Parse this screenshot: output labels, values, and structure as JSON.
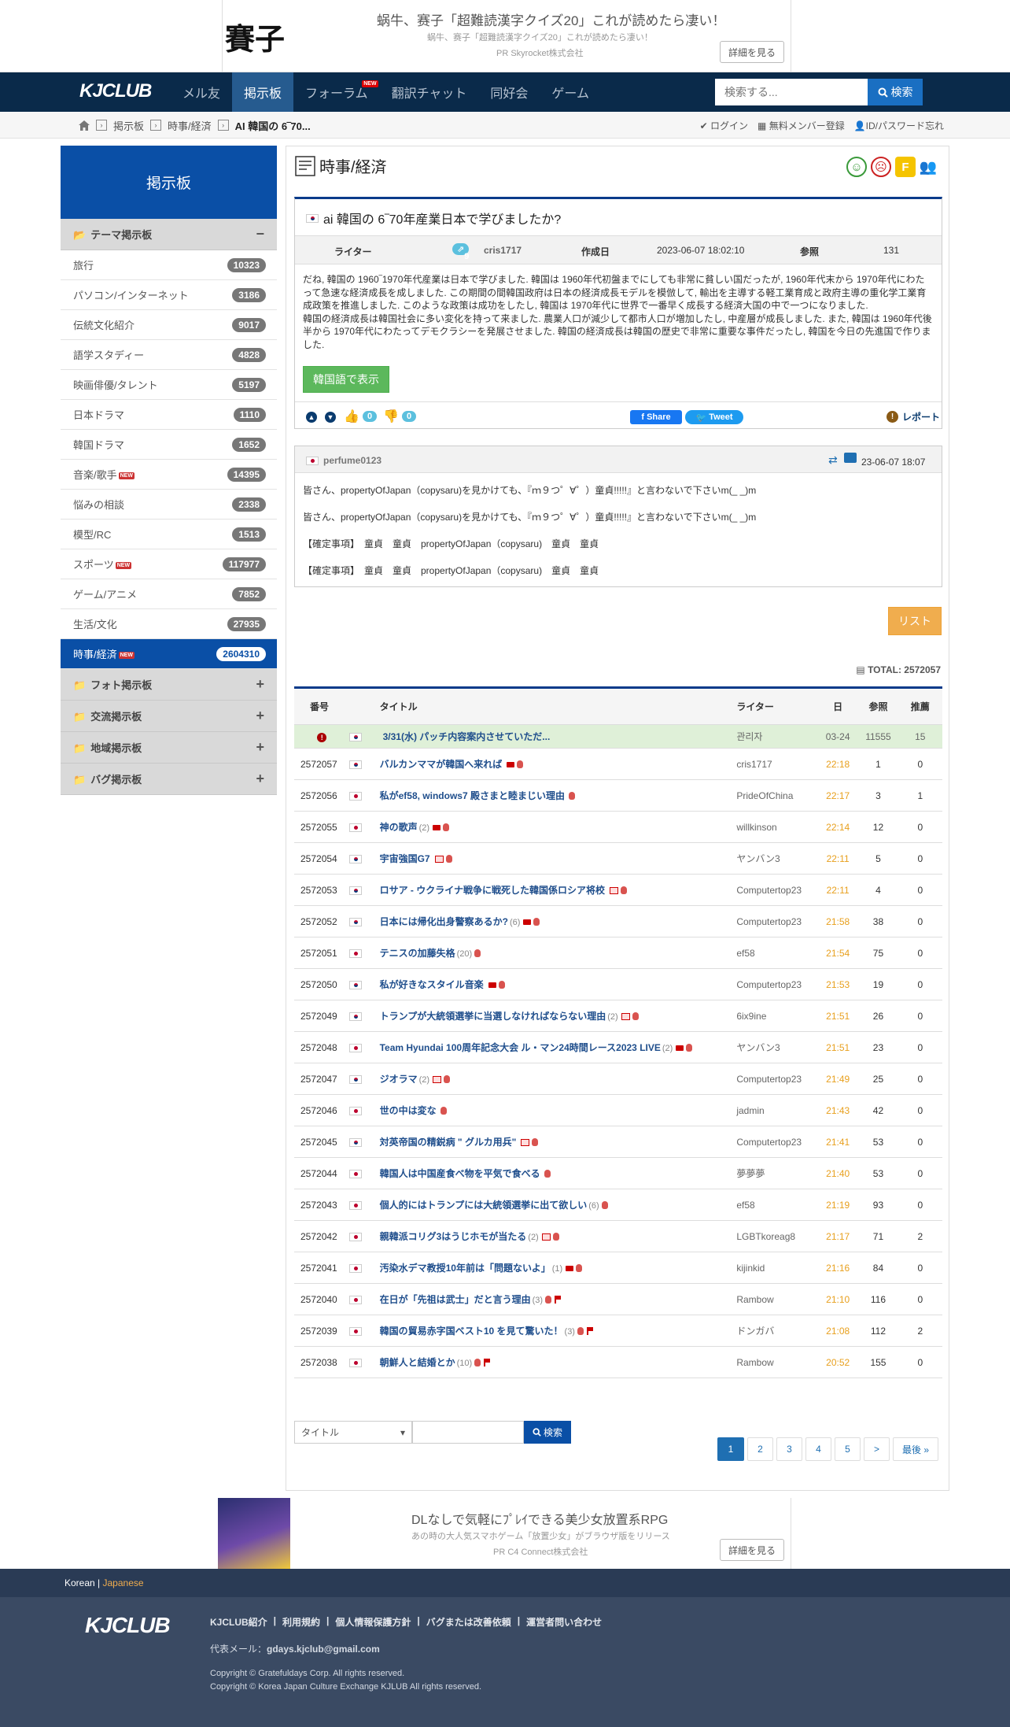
{
  "top_ad": {
    "thumb": "賽子",
    "headline": "蜗牛、赛子「超難読漢字クイズ20」これが読めたら凄い！",
    "sub": "蜗牛、赛子「超難読漢字クイズ20」これが読めたら凄い！",
    "pr": "PR  Skyrocket株式会社",
    "more": "詳細を見る"
  },
  "navbar": {
    "logo": "KJCLUB",
    "items": [
      "メル友",
      "掲示板",
      "フォーラム",
      "翻訳チャット",
      "同好会",
      "ゲーム"
    ],
    "new_badge": "NEW",
    "search_placeholder": "検索する...",
    "search_btn": "検索"
  },
  "breadcrumb": {
    "items": [
      "掲示板",
      "時事/経済",
      "AI 韓国の 6‾70..."
    ]
  },
  "account": {
    "login": "ログイン",
    "register": "無料メンバー登録",
    "forgot": "ID/パスワード忘れ"
  },
  "sidebar": {
    "title": "掲示板",
    "section_theme": "テーマ掲示板",
    "items": [
      {
        "label": "旅行",
        "count": "10323"
      },
      {
        "label": "パソコン/インターネット",
        "count": "3186"
      },
      {
        "label": "伝統文化紹介",
        "count": "9017"
      },
      {
        "label": "語学スタディー",
        "count": "4828"
      },
      {
        "label": "映画俳優/タレント",
        "count": "5197"
      },
      {
        "label": "日本ドラマ",
        "count": "1110"
      },
      {
        "label": "韓国ドラマ",
        "count": "1652"
      },
      {
        "label": "音楽/歌手",
        "count": "14395"
      },
      {
        "label": "悩みの相談",
        "count": "2338"
      },
      {
        "label": "模型/RC",
        "count": "1513"
      },
      {
        "label": "スポーツ",
        "count": "117977"
      },
      {
        "label": "ゲーム/アニメ",
        "count": "7852"
      },
      {
        "label": "生活/文化",
        "count": "27935"
      },
      {
        "label": "時事/経済",
        "count": "2604310"
      }
    ],
    "sections": [
      "フォト掲示板",
      "交流掲示板",
      "地域掲示板",
      "バグ掲示板"
    ]
  },
  "main": {
    "title": "時事/経済",
    "post": {
      "subject": "ai 韓国の 6‾70年産業日本で学びましたか?",
      "writer_label": "ライター",
      "level": "9",
      "writer": "cris1717",
      "date_label": "作成日",
      "date": "2023-06-07 18:02:10",
      "views_label": "参照",
      "views": "131",
      "body": "だね, 韓国の 1960‾1970年代産業は日本で学びました. 韓国は 1960年代初盤までにしても非常に貧しい国だったが, 1960年代末から 1970年代にわたって急速な経済成長を成しました. この期間の間韓国政府は日本の経済成長モデルを模倣して, 輸出を主導する軽工業育成と政府主導の重化学工業育成政策を推進しました. このような政策は成功をしたし, 韓国は 1970年代に世界で一番早く成長する経済大国の中で一つになりました.\n韓国の経済成長は韓国社会に多い変化を持って来ました. 農業人口が減少して都市人口が増加したし, 中産層が成長しました. また, 韓国は 1960年代後半から 1970年代にわたってデモクラシーを発展させました. 韓国の経済成長は韓国の歴史で非常に重要な事件だったし, 韓国を今日の先進国で作りました.",
      "btn_korean": "韓国語で表示",
      "likes": "0",
      "dislikes": "0",
      "share": "Share",
      "tweet": "Tweet",
      "report": "レポート"
    },
    "comment": {
      "writer": "perfume0123",
      "date": "23-06-07 18:07",
      "lines": [
        "皆さん、propertyOfJapan（copysaru)を見かけても、『ｍ９つ゜∀゜）童貞!!!!!』と言わないで下さいm(_ _)m",
        "皆さん、propertyOfJapan（copysaru)を見かけても、『ｍ９つ゜∀゜）童貞!!!!!』と言わないで下さいm(_ _)m",
        "【確定事項】　童貞　童貞　propertyOfJapan（copysaru)　童貞　童貞",
        "【確定事項】　童貞　童貞　propertyOfJapan（copysaru)　童貞　童貞"
      ]
    },
    "list_btn": "リスト",
    "total": "TOTAL: 2572057",
    "table": {
      "headers": [
        "番号",
        "タイトル",
        "ライター",
        "日",
        "参照",
        "推薦"
      ],
      "notice": {
        "flag": "kr",
        "title": "3/31(水) パッチ内容案内させていただ...",
        "writer": "관리자",
        "date": "03-24",
        "views": "11555",
        "rec": "15"
      },
      "rows": [
        {
          "no": "2572057",
          "flag": "kr",
          "title": "バルカンママが韓国へ来れば",
          "rep": "",
          "icons": [
            "v",
            "f"
          ],
          "writer": "cris1717",
          "time": "22:18",
          "views": "1",
          "rec": "0"
        },
        {
          "no": "2572056",
          "flag": "jp",
          "title": "私がef58, windows7 殿さまと睦まじい理由",
          "rep": "",
          "icons": [
            "f"
          ],
          "writer": "PrideOfChina",
          "time": "22:17",
          "views": "3",
          "rec": "1"
        },
        {
          "no": "2572055",
          "flag": "jp",
          "title": "神の歌声",
          "rep": "(2)",
          "icons": [
            "v",
            "f"
          ],
          "writer": "willkinson",
          "time": "22:14",
          "views": "12",
          "rec": "0"
        },
        {
          "no": "2572054",
          "flag": "kr",
          "title": "宇宙強国G7",
          "rep": "",
          "icons": [
            "p",
            "f"
          ],
          "writer": "ヤンバン3",
          "time": "22:11",
          "views": "5",
          "rec": "0"
        },
        {
          "no": "2572053",
          "flag": "kr",
          "title": "ロサア - ウクライナ戦争に戦死した韓国係ロシア将校",
          "rep": "",
          "icons": [
            "p",
            "f"
          ],
          "writer": "Computertop23",
          "time": "22:11",
          "views": "4",
          "rec": "0"
        },
        {
          "no": "2572052",
          "flag": "kr",
          "title": "日本には帰化出身警察あるか?",
          "rep": "(6)",
          "icons": [
            "v",
            "f"
          ],
          "writer": "Computertop23",
          "time": "21:58",
          "views": "38",
          "rec": "0"
        },
        {
          "no": "2572051",
          "flag": "jp",
          "title": "テニスの加藤失格",
          "rep": "(20)",
          "icons": [
            "f"
          ],
          "writer": "ef58",
          "time": "21:54",
          "views": "75",
          "rec": "0"
        },
        {
          "no": "2572050",
          "flag": "kr",
          "title": "私が好きなスタイル音楽",
          "rep": "",
          "icons": [
            "v",
            "f"
          ],
          "writer": "Computertop23",
          "time": "21:53",
          "views": "19",
          "rec": "0"
        },
        {
          "no": "2572049",
          "flag": "kr",
          "title": "トランプが大統領選挙に当選しなければならない理由",
          "rep": "(2)",
          "icons": [
            "p",
            "f"
          ],
          "writer": "6ix9ine",
          "time": "21:51",
          "views": "26",
          "rec": "0"
        },
        {
          "no": "2572048",
          "flag": "jp",
          "title": "Team Hyundai 100周年記念大会 ル・マン24時間レース2023 LIVE",
          "rep": "(2)",
          "icons": [
            "v",
            "f"
          ],
          "writer": "ヤンバン3",
          "time": "21:51",
          "views": "23",
          "rec": "0"
        },
        {
          "no": "2572047",
          "flag": "kr",
          "title": "ジオラマ",
          "rep": "(2)",
          "icons": [
            "p",
            "f"
          ],
          "writer": "Computertop23",
          "time": "21:49",
          "views": "25",
          "rec": "0"
        },
        {
          "no": "2572046",
          "flag": "jp",
          "title": "世の中は変な",
          "rep": "",
          "icons": [
            "f"
          ],
          "writer": "jadmin",
          "time": "21:43",
          "views": "42",
          "rec": "0"
        },
        {
          "no": "2572045",
          "flag": "kr",
          "title": "対英帝国の精鋭病 \" グルカ用兵\"",
          "rep": "",
          "icons": [
            "p",
            "f"
          ],
          "writer": "Computertop23",
          "time": "21:41",
          "views": "53",
          "rec": "0"
        },
        {
          "no": "2572044",
          "flag": "jp",
          "title": "韓国人は中国産食べ物を平気で食べる",
          "rep": "",
          "icons": [
            "f"
          ],
          "writer": "夢夢夢",
          "time": "21:40",
          "views": "53",
          "rec": "0"
        },
        {
          "no": "2572043",
          "flag": "jp",
          "title": "個人的にはトランプには大統領選挙に出て欲しい",
          "rep": "(6)",
          "icons": [
            "f"
          ],
          "writer": "ef58",
          "time": "21:19",
          "views": "93",
          "rec": "0"
        },
        {
          "no": "2572042",
          "flag": "jp",
          "title": "親韓派コリグ3はうじホモが当たる",
          "rep": "(2)",
          "icons": [
            "p",
            "f"
          ],
          "writer": "LGBTkoreag8",
          "time": "21:17",
          "views": "71",
          "rec": "2"
        },
        {
          "no": "2572041",
          "flag": "jp",
          "title": "汚染水デマ教授10年前は「問題ないよ」",
          "rep": "(1)",
          "icons": [
            "v",
            "f"
          ],
          "writer": "kijinkid",
          "time": "21:16",
          "views": "84",
          "rec": "0"
        },
        {
          "no": "2572040",
          "flag": "jp",
          "title": "在日が「先祖は武士」だと言う理由",
          "rep": "(3)",
          "icons": [
            "f",
            "l"
          ],
          "writer": "Rambow",
          "time": "21:10",
          "views": "116",
          "rec": "0"
        },
        {
          "no": "2572039",
          "flag": "jp",
          "title": "韓国の貿易赤字国ベスト10 を見て驚いた！",
          "rep": "(3)",
          "icons": [
            "f",
            "l"
          ],
          "writer": "ドンガバ",
          "time": "21:08",
          "views": "112",
          "rec": "2"
        },
        {
          "no": "2572038",
          "flag": "jp",
          "title": "朝鮮人と結婚とか",
          "rep": "(10)",
          "icons": [
            "f",
            "l"
          ],
          "writer": "Rambow",
          "time": "20:52",
          "views": "155",
          "rec": "0"
        }
      ]
    },
    "search": {
      "select": "タイトル",
      "btn": "検索"
    },
    "pager": [
      "1",
      "2",
      "3",
      "4",
      "5",
      ">",
      "最後 »"
    ]
  },
  "bottom_ad": {
    "headline": "DLなしで気軽にﾌﾟﾚｲできる美少女放置系RPG",
    "sub": "あの時の大人気スマホゲーム「放置少女」がブラウザ版をリリース",
    "pr": "PR  C4 Connect株式会社",
    "more": "詳細を見る"
  },
  "footer": {
    "lang_ko": "Korean",
    "lang_sep": " | ",
    "lang_ja": "Japanese",
    "logo": "KJCLUB",
    "links": [
      "KJCLUB紹介",
      "利用規約",
      "個人情報保護方針",
      "バグまたは改善依頼",
      "運営者問い合わせ"
    ],
    "mail_label": "代表メール：",
    "mail": "gdays.kjclub@gmail.com",
    "copy1": "Copyright © Gratefuldays Corp. All rights reserved.",
    "copy2": "Copyright © Korea Japan Culture Exchange KJLUB All rights reserved."
  }
}
